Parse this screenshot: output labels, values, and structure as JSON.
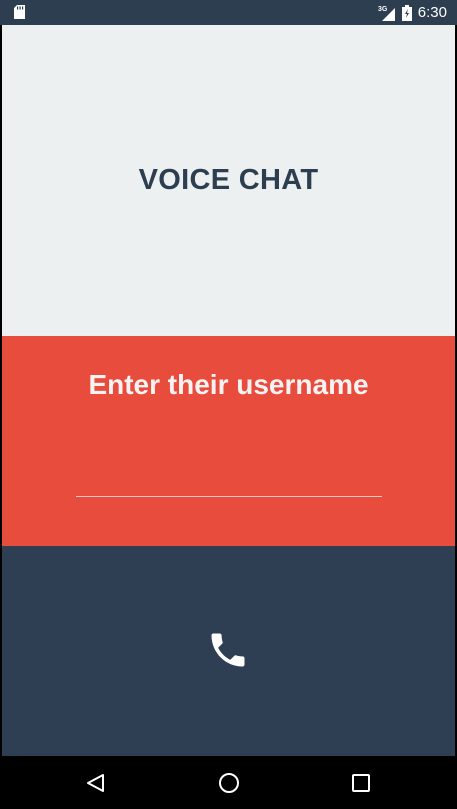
{
  "status_bar": {
    "network": "3G",
    "time": "6:30"
  },
  "app": {
    "title": "VOICE CHAT",
    "prompt": "Enter their username",
    "username_input": {
      "value": "",
      "placeholder": ""
    },
    "call_button_icon": "phone-icon"
  },
  "nav_bar": {
    "icons": [
      "back-icon",
      "home-icon",
      "recents-icon"
    ]
  },
  "colors": {
    "title_bg": "#ecf0f1",
    "title_text": "#2c3e50",
    "input_bg": "#e74c3c",
    "call_bg": "#2e3f53",
    "status_bg": "#2c3e50"
  }
}
